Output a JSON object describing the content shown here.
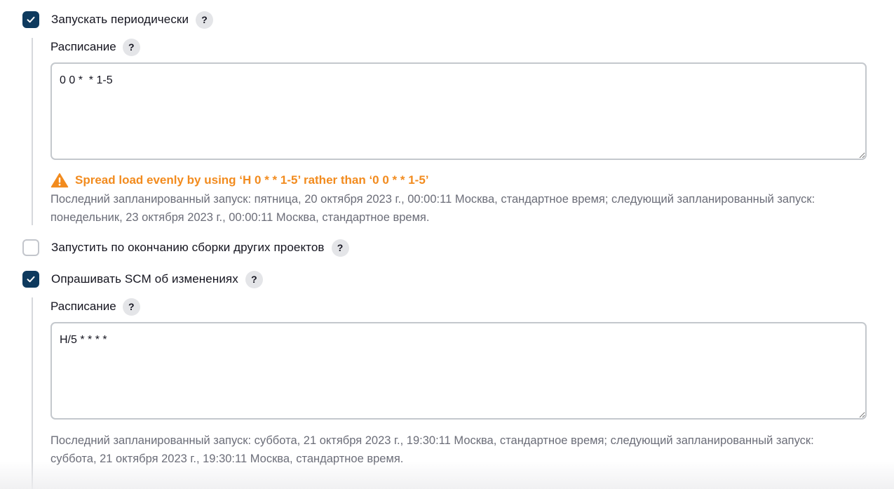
{
  "periodic": {
    "label": "Запускать периодически",
    "checked": true,
    "help": "?",
    "schedule_label": "Расписание",
    "schedule_help": "?",
    "schedule_value": "0 0 *  * 1-5",
    "warning_text": "Spread load evenly by using ‘H 0 *  * 1-5’ rather than ‘0 0 *  * 1-5’",
    "info_line1": "Последний запланированный запуск: пятница, 20 октября 2023 г., 00:00:11 Москва, стандартное время; следующий запланированный запуск:",
    "info_line2": "понедельник, 23 октября 2023 г., 00:00:11 Москва, стандартное время."
  },
  "after_other": {
    "label": "Запустить по окончанию сборки других проектов",
    "checked": false,
    "help": "?"
  },
  "poll_scm": {
    "label": "Опрашивать SCM об изменениях",
    "checked": true,
    "help": "?",
    "schedule_label": "Расписание",
    "schedule_help": "?",
    "schedule_value": "H/5 * * * *",
    "info_line1": "Последний запланированный запуск: суббота, 21 октября 2023 г., 19:30:11 Москва, стандартное время; следующий запланированный запуск:",
    "info_line2": "суббота, 21 октября 2023 г., 19:30:11 Москва, стандартное время."
  },
  "colors": {
    "checkbox_checked": "#0e3a5e",
    "warning": "#f28b1e",
    "info_text": "#6b6d78"
  },
  "icons": {
    "check": "check-icon",
    "help": "help-icon",
    "warning": "warning-triangle-icon",
    "resize": "resize-grip-icon"
  }
}
